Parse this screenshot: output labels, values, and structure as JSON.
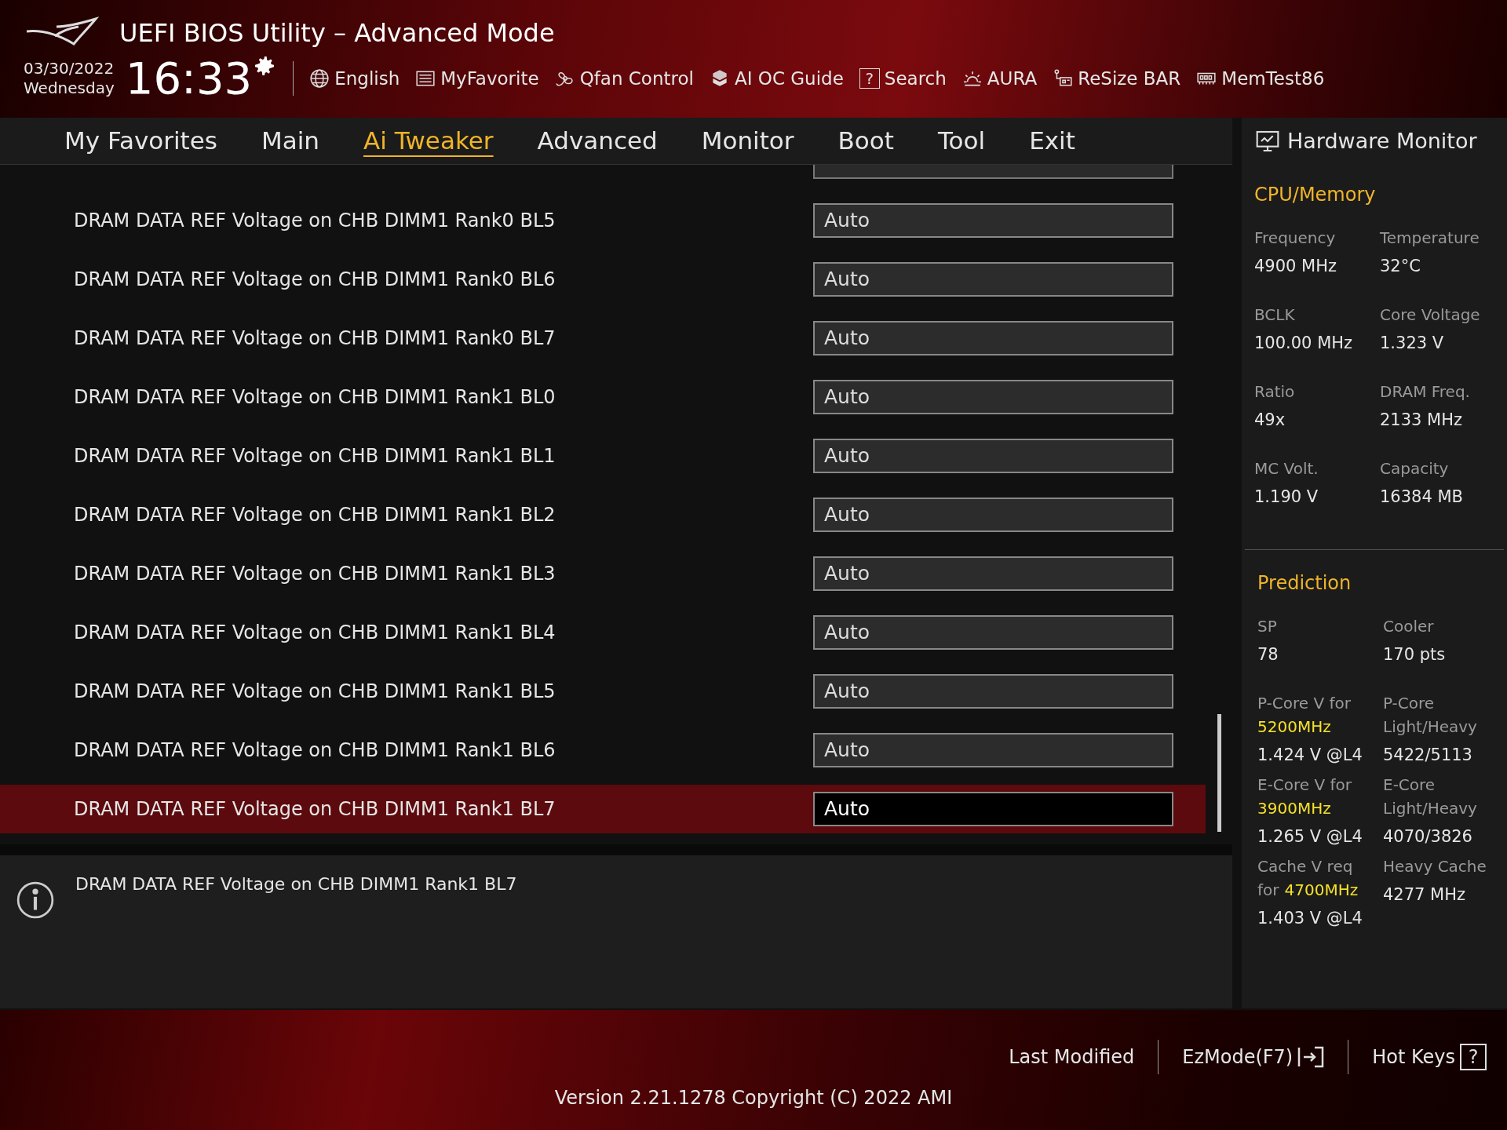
{
  "header": {
    "title": "UEFI BIOS Utility – Advanced Mode",
    "date": "03/30/2022",
    "weekday": "Wednesday",
    "time": "16:33",
    "tools": [
      {
        "kind": "globe",
        "label": "English"
      },
      {
        "kind": "list",
        "label": "MyFavorite"
      },
      {
        "kind": "fan",
        "label": "Qfan Control"
      },
      {
        "kind": "chip",
        "label": "AI OC Guide"
      },
      {
        "kind": "help",
        "label": "Search",
        "icon_text": "?"
      },
      {
        "kind": "aura",
        "label": "AURA"
      },
      {
        "kind": "bar",
        "label": "ReSize BAR"
      },
      {
        "kind": "memory",
        "label": "MemTest86"
      }
    ]
  },
  "tabs": [
    {
      "label": "My Favorites",
      "selected": false
    },
    {
      "label": "Main",
      "selected": false
    },
    {
      "label": "Ai Tweaker",
      "selected": true
    },
    {
      "label": "Advanced",
      "selected": false
    },
    {
      "label": "Monitor",
      "selected": false
    },
    {
      "label": "Boot",
      "selected": false
    },
    {
      "label": "Tool",
      "selected": false
    },
    {
      "label": "Exit",
      "selected": false
    }
  ],
  "settings": [
    {
      "label": "DRAM DATA REF Voltage on CHB DIMM1 Rank0 BL5",
      "value": "Auto",
      "selected": false
    },
    {
      "label": "DRAM DATA REF Voltage on CHB DIMM1 Rank0 BL6",
      "value": "Auto",
      "selected": false
    },
    {
      "label": "DRAM DATA REF Voltage on CHB DIMM1 Rank0 BL7",
      "value": "Auto",
      "selected": false
    },
    {
      "label": "DRAM DATA REF Voltage on CHB DIMM1 Rank1 BL0",
      "value": "Auto",
      "selected": false
    },
    {
      "label": "DRAM DATA REF Voltage on CHB DIMM1 Rank1 BL1",
      "value": "Auto",
      "selected": false
    },
    {
      "label": "DRAM DATA REF Voltage on CHB DIMM1 Rank1 BL2",
      "value": "Auto",
      "selected": false
    },
    {
      "label": "DRAM DATA REF Voltage on CHB DIMM1 Rank1 BL3",
      "value": "Auto",
      "selected": false
    },
    {
      "label": "DRAM DATA REF Voltage on CHB DIMM1 Rank1 BL4",
      "value": "Auto",
      "selected": false
    },
    {
      "label": "DRAM DATA REF Voltage on CHB DIMM1 Rank1 BL5",
      "value": "Auto",
      "selected": false
    },
    {
      "label": "DRAM DATA REF Voltage on CHB DIMM1 Rank1 BL6",
      "value": "Auto",
      "selected": false
    },
    {
      "label": "DRAM DATA REF Voltage on CHB DIMM1 Rank1 BL7",
      "value": "Auto",
      "selected": true
    }
  ],
  "help_text": "DRAM DATA REF Voltage on CHB DIMM1 Rank1 BL7",
  "hardware_monitor": {
    "title": "Hardware Monitor",
    "sections": [
      {
        "title": "CPU/Memory",
        "cells": [
          {
            "lines": [
              [
                {
                  "text": "Frequency",
                  "highlight": false
                }
              ]
            ],
            "value": "4900 MHz"
          },
          {
            "lines": [
              [
                {
                  "text": "Temperature",
                  "highlight": false
                }
              ]
            ],
            "value": "32°C"
          },
          {
            "lines": [
              [
                {
                  "text": "BCLK",
                  "highlight": false
                }
              ]
            ],
            "value": "100.00 MHz"
          },
          {
            "lines": [
              [
                {
                  "text": "Core Voltage",
                  "highlight": false
                }
              ]
            ],
            "value": "1.323 V"
          },
          {
            "lines": [
              [
                {
                  "text": "Ratio",
                  "highlight": false
                }
              ]
            ],
            "value": "49x"
          },
          {
            "lines": [
              [
                {
                  "text": "DRAM Freq.",
                  "highlight": false
                }
              ]
            ],
            "value": "2133 MHz"
          },
          {
            "lines": [
              [
                {
                  "text": "MC Volt.",
                  "highlight": false
                }
              ]
            ],
            "value": "1.190 V"
          },
          {
            "lines": [
              [
                {
                  "text": "Capacity",
                  "highlight": false
                }
              ]
            ],
            "value": "16384 MB"
          }
        ]
      },
      {
        "title": "Prediction",
        "cells": [
          {
            "lines": [
              [
                {
                  "text": "SP",
                  "highlight": false
                }
              ]
            ],
            "value": "78"
          },
          {
            "lines": [
              [
                {
                  "text": "Cooler",
                  "highlight": false
                }
              ]
            ],
            "value": "170 pts"
          },
          {
            "lines": [
              [
                {
                  "text": "P-Core V for",
                  "highlight": false
                }
              ],
              [
                {
                  "text": "5200MHz",
                  "highlight": true
                }
              ]
            ],
            "value": "1.424 V @L4"
          },
          {
            "lines": [
              [
                {
                  "text": "P-Core",
                  "highlight": false
                }
              ],
              [
                {
                  "text": "Light/Heavy",
                  "highlight": false
                }
              ]
            ],
            "value": "5422/5113"
          },
          {
            "lines": [
              [
                {
                  "text": "E-Core V for",
                  "highlight": false
                }
              ],
              [
                {
                  "text": "3900MHz",
                  "highlight": true
                }
              ]
            ],
            "value": "1.265 V @L4"
          },
          {
            "lines": [
              [
                {
                  "text": "E-Core",
                  "highlight": false
                }
              ],
              [
                {
                  "text": "Light/Heavy",
                  "highlight": false
                }
              ]
            ],
            "value": "4070/3826"
          },
          {
            "lines": [
              [
                {
                  "text": "Cache V req",
                  "highlight": false
                }
              ],
              [
                {
                  "text": "for",
                  "highlight": false
                },
                {
                  "text": "4700MHz",
                  "highlight": true
                }
              ]
            ],
            "value": "1.403 V @L4"
          },
          {
            "lines": [
              [
                {
                  "text": "Heavy Cache",
                  "highlight": false
                }
              ]
            ],
            "value": "4277 MHz"
          }
        ]
      }
    ]
  },
  "footer": {
    "actions": [
      {
        "kind": "plain",
        "label": "Last Modified"
      },
      {
        "kind": "exit",
        "label": "EzMode(F7)"
      },
      {
        "kind": "help",
        "label": "Hot Keys",
        "icon_text": "?"
      }
    ],
    "version": "Version 2.21.1278 Copyright (C) 2022 AMI"
  }
}
